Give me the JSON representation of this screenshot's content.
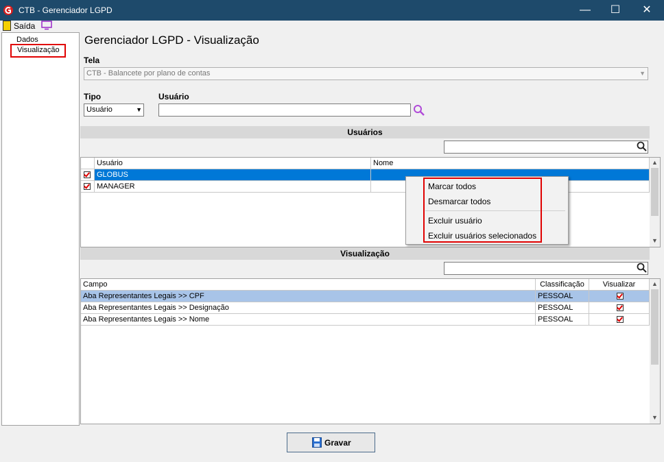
{
  "window": {
    "title": "CTB - Gerenciador LGPD"
  },
  "menubar": {
    "exit_label": "Saída"
  },
  "tree": {
    "items": [
      "Dados",
      "Visualização"
    ]
  },
  "header": {
    "title": "Gerenciador LGPD - Visualização"
  },
  "form": {
    "tela_label": "Tela",
    "tela_value": "CTB - Balancete por plano de contas",
    "tipo_label": "Tipo",
    "tipo_value": "Usuário",
    "usuario_label": "Usuário",
    "usuario_value": ""
  },
  "users_section": {
    "title": "Usuários",
    "columns": [
      "Usuário",
      "Nome"
    ],
    "rows": [
      {
        "usuario": "GLOBUS",
        "nome": "",
        "checked": true
      },
      {
        "usuario": "MANAGER",
        "nome": "",
        "checked": true
      }
    ]
  },
  "context_menu": {
    "items": [
      "Marcar todos",
      "Desmarcar todos",
      "Excluir usuário",
      "Excluir usuários selecionados"
    ]
  },
  "view_section": {
    "title": "Visualização",
    "columns": [
      "Campo",
      "Classificação",
      "Visualizar"
    ],
    "rows": [
      {
        "campo": "Aba Representantes Legais >> CPF",
        "classificacao": "PESSOAL",
        "visualizar": true
      },
      {
        "campo": "Aba Representantes Legais >> Designação",
        "classificacao": "PESSOAL",
        "visualizar": true
      },
      {
        "campo": "Aba Representantes Legais >> Nome",
        "classificacao": "PESSOAL",
        "visualizar": true
      }
    ]
  },
  "footer": {
    "save_label": "Gravar"
  },
  "colors": {
    "titlebar": "#1e4a6b",
    "selection": "#0078d7",
    "highlight_row": "#a8c4e8",
    "annotation": "#e00000"
  }
}
